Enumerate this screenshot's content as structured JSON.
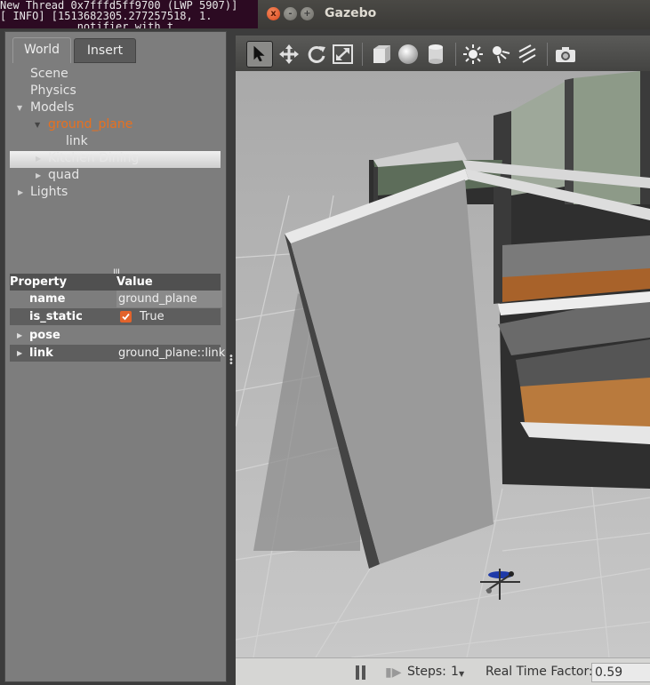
{
  "terminal": {
    "lines": [
      "New Thread 0x7fffd5ff9700 (LWP 5907)]",
      "[ INFO] [1513682305.277257518, 1.",
      "            notifier with t"
    ]
  },
  "window": {
    "title": "Gazebo",
    "close_glyph": "x",
    "min_glyph": "-",
    "max_glyph": "+"
  },
  "tabs": {
    "world": "World",
    "insert": "Insert"
  },
  "tree": {
    "scene": "Scene",
    "physics": "Physics",
    "models": "Models",
    "ground_plane": "ground_plane",
    "link": "link",
    "kitchen": "Kitchen Dining",
    "quad": "quad",
    "lights": "Lights"
  },
  "properties": {
    "header_property": "Property",
    "header_value": "Value",
    "rows": [
      {
        "key": "name",
        "value": "ground_plane"
      },
      {
        "key": "is_static",
        "value": "True"
      },
      {
        "key": "pose",
        "value": ""
      },
      {
        "key": "link",
        "value": "ground_plane::link"
      }
    ],
    "grip": "|||"
  },
  "toolbar": {
    "icons": [
      "select-arrow-icon",
      "translate-icon",
      "rotate-icon",
      "scale-icon",
      "box-icon",
      "sphere-icon",
      "cylinder-icon",
      "sun-icon",
      "spot-light-icon",
      "directional-light-icon",
      "camera-icon"
    ]
  },
  "status": {
    "steps_label": "Steps:",
    "steps_value": "1",
    "rtf_label": "Real Time Factor:",
    "rtf_value": "0.59"
  },
  "colors": {
    "selection_text": "#e8701e",
    "terminal_bg": "#2c0a22",
    "checkbox": "#e2632b"
  }
}
